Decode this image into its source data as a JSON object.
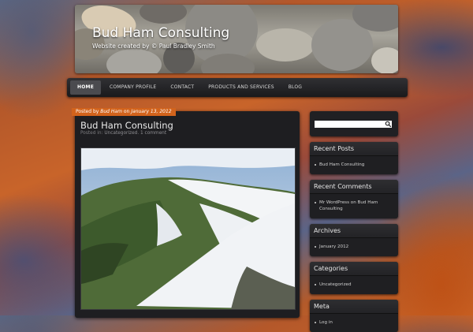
{
  "header": {
    "title": "Bud Ham Consulting",
    "description": "Website created by © Paul Bradley Smith"
  },
  "nav": {
    "items": [
      {
        "label": "HOME",
        "active": true
      },
      {
        "label": "COMPANY PROFILE",
        "active": false
      },
      {
        "label": "CONTACT",
        "active": false
      },
      {
        "label": "PRODUCTS AND SERVICES",
        "active": false
      },
      {
        "label": "BLOG",
        "active": false
      }
    ]
  },
  "post": {
    "meta_prefix": "Posted by",
    "author": "Bud Ham",
    "meta_on": "on",
    "date": "January 13, 2012",
    "title": "Bud Ham Consulting",
    "posted_in": "Posted in:",
    "category": "Uncategorized",
    "separator": ".",
    "comments": "1 comment"
  },
  "sidebar": {
    "search_placeholder": "",
    "widgets": [
      {
        "title": "Recent Posts",
        "items": [
          "Bud Ham Consulting"
        ]
      },
      {
        "title": "Recent Comments",
        "items": [
          "Mr WordPress on Bud Ham Consulting"
        ]
      },
      {
        "title": "Archives",
        "items": [
          "January 2012"
        ]
      },
      {
        "title": "Categories",
        "items": [
          "Uncategorized"
        ]
      },
      {
        "title": "Meta",
        "items": [
          "Log in"
        ]
      }
    ]
  },
  "colors": {
    "accent": "#d2631c",
    "panel": "#1e1e21",
    "nav_active": "#4b4b4f"
  }
}
